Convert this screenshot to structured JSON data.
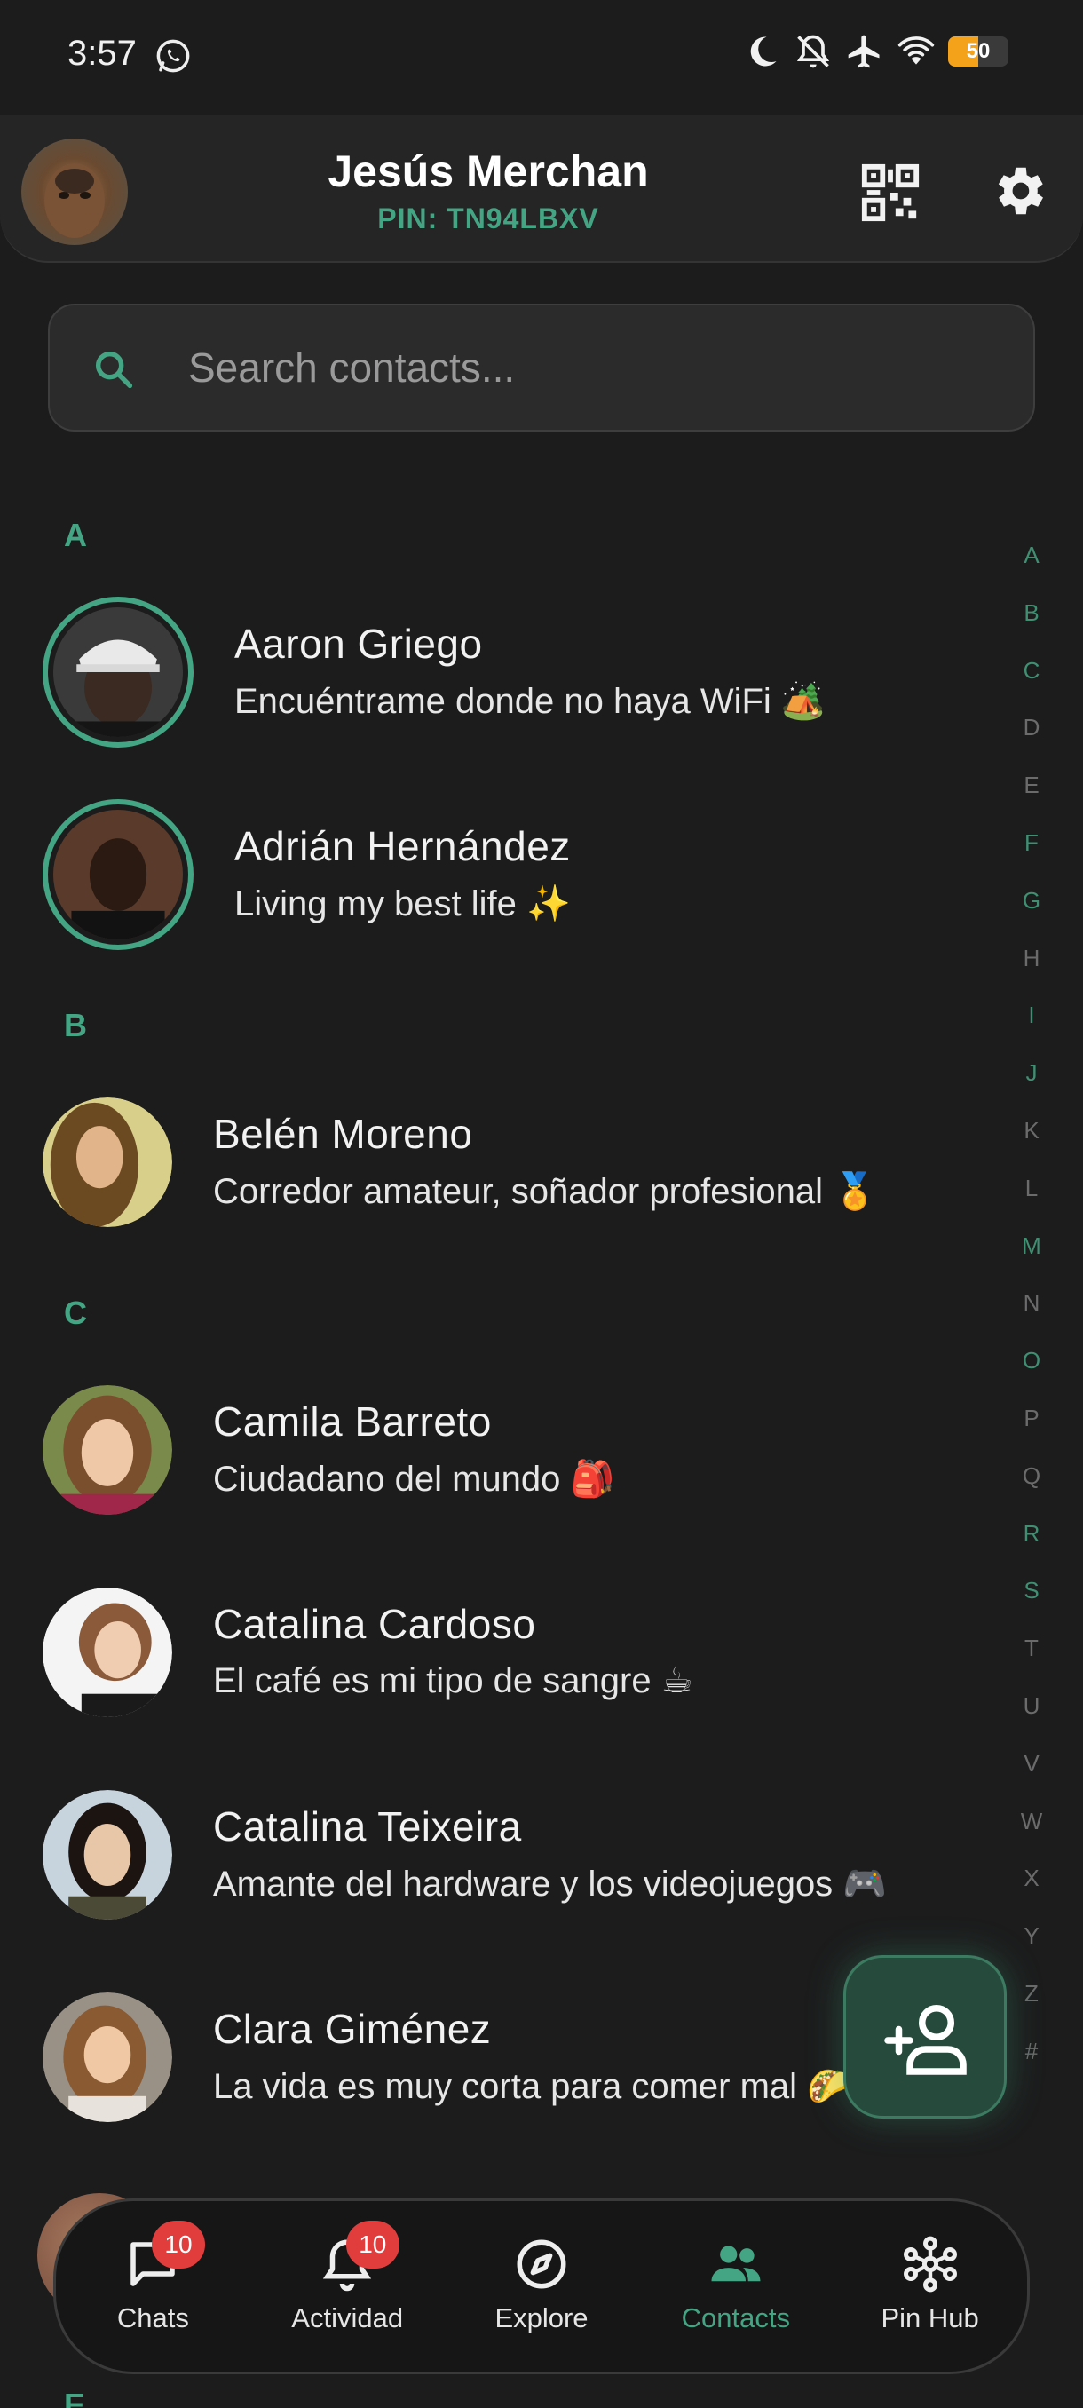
{
  "status_bar": {
    "time": "3:57",
    "battery_level": 50,
    "battery_text": "50",
    "icons": [
      "whatsapp-icon",
      "moon-icon",
      "bell-off-icon",
      "airplane-icon",
      "wifi-icon",
      "battery-icon"
    ]
  },
  "header": {
    "name": "Jesús Merchan",
    "pin": "PIN: TN94LBXV",
    "icons": [
      "qr-code-icon",
      "gear-icon"
    ]
  },
  "search": {
    "placeholder": "Search contacts...",
    "value": ""
  },
  "sections": [
    {
      "letter": "A",
      "contacts": [
        {
          "name": "Aaron Griego",
          "status": "Encuéntrame donde no haya WiFi 🏕️",
          "has_story": true
        },
        {
          "name": "Adrián Hernández",
          "status": "Living my best life ✨",
          "has_story": true
        }
      ]
    },
    {
      "letter": "B",
      "contacts": [
        {
          "name": "Belén Moreno",
          "status": "Corredor amateur, soñador profesional 🏅",
          "has_story": false
        }
      ]
    },
    {
      "letter": "C",
      "contacts": [
        {
          "name": "Camila Barreto",
          "status": "Ciudadano del mundo 🎒",
          "has_story": false
        },
        {
          "name": "Catalina Cardoso",
          "status": "El café es mi tipo de sangre ☕",
          "has_story": false
        },
        {
          "name": "Catalina Teixeira",
          "status": "Amante del hardware y los videojuegos 🎮",
          "has_story": false
        },
        {
          "name": "Clara Giménez",
          "status": "La vida es muy corta para comer mal 🌮",
          "has_story": false
        }
      ]
    }
  ],
  "next_section_letter": "E",
  "alphabet_index": [
    "A",
    "B",
    "C",
    "D",
    "E",
    "F",
    "G",
    "H",
    "I",
    "J",
    "K",
    "L",
    "M",
    "N",
    "O",
    "P",
    "Q",
    "R",
    "S",
    "T",
    "U",
    "V",
    "W",
    "X",
    "Y",
    "Z",
    "#"
  ],
  "alphabet_active": [
    "A",
    "B",
    "C",
    "F",
    "G",
    "I",
    "J",
    "M",
    "O",
    "R",
    "S"
  ],
  "colors": {
    "accent": "#43a583",
    "background": "#1c1c1d",
    "badge": "#e23d3d"
  },
  "fab": {
    "icon": "add-person-icon"
  },
  "bottom_nav": [
    {
      "label": "Chats",
      "icon": "chat-bubble-icon",
      "badge": "10",
      "active": false
    },
    {
      "label": "Actividad",
      "icon": "bell-icon",
      "badge": "10",
      "active": false
    },
    {
      "label": "Explore",
      "icon": "compass-icon",
      "badge": "",
      "active": false
    },
    {
      "label": "Contacts",
      "icon": "people-icon",
      "badge": "",
      "active": true
    },
    {
      "label": "Pin Hub",
      "icon": "hub-icon",
      "badge": "",
      "active": false
    }
  ]
}
